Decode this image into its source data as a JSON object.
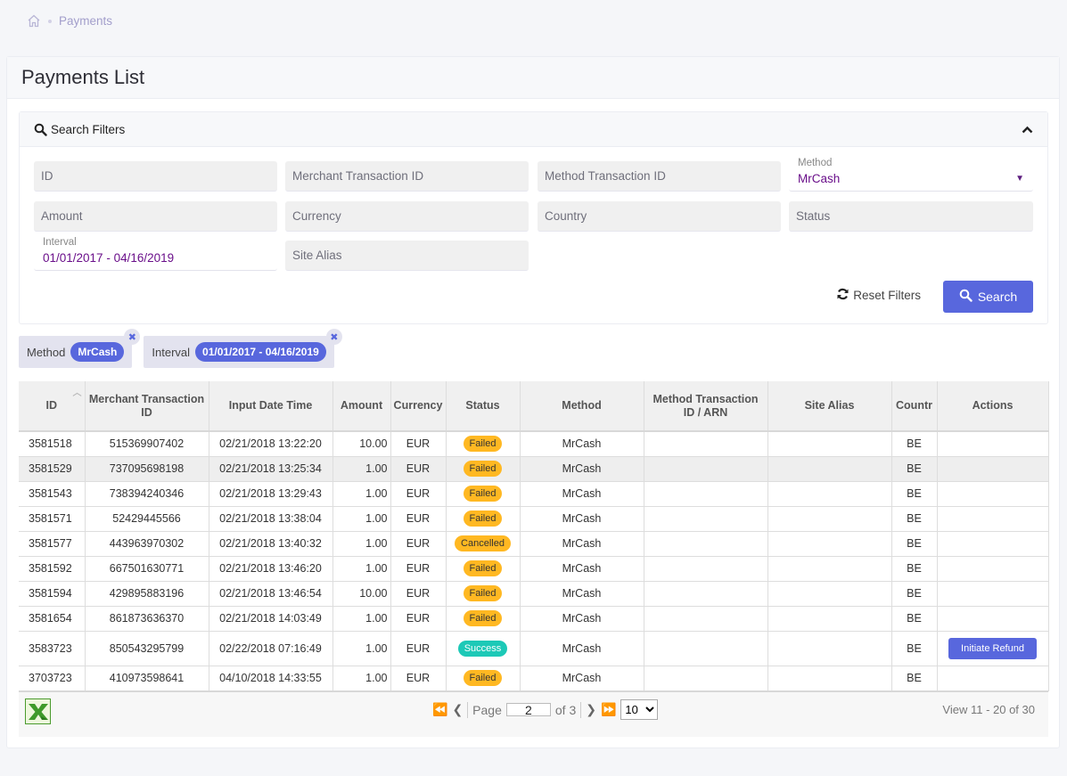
{
  "breadcrumb": {
    "home_icon": "home-icon",
    "current": "Payments"
  },
  "page": {
    "title": "Payments List"
  },
  "filters": {
    "title": "Search Filters",
    "fields": {
      "id": {
        "placeholder": "ID"
      },
      "merchant_tx_id": {
        "placeholder": "Merchant Transaction ID"
      },
      "method_tx_id": {
        "placeholder": "Method Transaction ID"
      },
      "method": {
        "label": "Method",
        "value": "MrCash"
      },
      "amount": {
        "placeholder": "Amount"
      },
      "currency": {
        "placeholder": "Currency"
      },
      "country": {
        "placeholder": "Country"
      },
      "status": {
        "placeholder": "Status"
      },
      "interval": {
        "label": "Interval",
        "value": "01/01/2017 - 04/16/2019"
      },
      "site_alias": {
        "placeholder": "Site Alias"
      }
    },
    "reset_label": "Reset Filters",
    "search_label": "Search"
  },
  "chips": [
    {
      "label": "Method",
      "value": "MrCash"
    },
    {
      "label": "Interval",
      "value": "01/01/2017 - 04/16/2019"
    }
  ],
  "table": {
    "columns": [
      "ID",
      "Merchant Transaction ID",
      "Input Date Time",
      "Amount",
      "Currency",
      "Status",
      "Method",
      "Method Transaction ID / ARN",
      "Site Alias",
      "Country",
      "Actions"
    ],
    "column_display": [
      "ID",
      "Merchant Transaction ID",
      "Input Date Time",
      "Amount",
      "Currency",
      "Status",
      "Method",
      "Method Transaction ID / ARN",
      "Site Alias",
      "Countr",
      "Actions"
    ],
    "rows": [
      {
        "id": "3581518",
        "merchant_tx": "515369907402",
        "datetime": "02/21/2018 13:22:20",
        "amount": "10.00",
        "currency": "EUR",
        "status": "Failed",
        "method": "MrCash",
        "method_tx": "",
        "site_alias": "",
        "country": "BE",
        "action": ""
      },
      {
        "id": "3581529",
        "merchant_tx": "737095698198",
        "datetime": "02/21/2018 13:25:34",
        "amount": "1.00",
        "currency": "EUR",
        "status": "Failed",
        "method": "MrCash",
        "method_tx": "",
        "site_alias": "",
        "country": "BE",
        "action": ""
      },
      {
        "id": "3581543",
        "merchant_tx": "738394240346",
        "datetime": "02/21/2018 13:29:43",
        "amount": "1.00",
        "currency": "EUR",
        "status": "Failed",
        "method": "MrCash",
        "method_tx": "",
        "site_alias": "",
        "country": "BE",
        "action": ""
      },
      {
        "id": "3581571",
        "merchant_tx": "52429445566",
        "datetime": "02/21/2018 13:38:04",
        "amount": "1.00",
        "currency": "EUR",
        "status": "Failed",
        "method": "MrCash",
        "method_tx": "",
        "site_alias": "",
        "country": "BE",
        "action": ""
      },
      {
        "id": "3581577",
        "merchant_tx": "443963970302",
        "datetime": "02/21/2018 13:40:32",
        "amount": "1.00",
        "currency": "EUR",
        "status": "Cancelled",
        "method": "MrCash",
        "method_tx": "",
        "site_alias": "",
        "country": "BE",
        "action": ""
      },
      {
        "id": "3581592",
        "merchant_tx": "667501630771",
        "datetime": "02/21/2018 13:46:20",
        "amount": "1.00",
        "currency": "EUR",
        "status": "Failed",
        "method": "MrCash",
        "method_tx": "",
        "site_alias": "",
        "country": "BE",
        "action": ""
      },
      {
        "id": "3581594",
        "merchant_tx": "429895883196",
        "datetime": "02/21/2018 13:46:54",
        "amount": "10.00",
        "currency": "EUR",
        "status": "Failed",
        "method": "MrCash",
        "method_tx": "",
        "site_alias": "",
        "country": "BE",
        "action": ""
      },
      {
        "id": "3581654",
        "merchant_tx": "861873636370",
        "datetime": "02/21/2018 14:03:49",
        "amount": "1.00",
        "currency": "EUR",
        "status": "Failed",
        "method": "MrCash",
        "method_tx": "",
        "site_alias": "",
        "country": "BE",
        "action": ""
      },
      {
        "id": "3583723",
        "merchant_tx": "850543295799",
        "datetime": "02/22/2018 07:16:49",
        "amount": "1.00",
        "currency": "EUR",
        "status": "Success",
        "method": "MrCash",
        "method_tx": "",
        "site_alias": "",
        "country": "BE",
        "action": "Initiate Refund"
      },
      {
        "id": "3703723",
        "merchant_tx": "410973598641",
        "datetime": "04/10/2018 14:33:55",
        "amount": "1.00",
        "currency": "EUR",
        "status": "Failed",
        "method": "MrCash",
        "method_tx": "",
        "site_alias": "",
        "country": "BE",
        "action": ""
      }
    ]
  },
  "status_colors": {
    "Failed": "#ffb822",
    "Cancelled": "#ffb822",
    "Success": "#1dc9b7"
  },
  "accent_color": "#5867dd",
  "pager": {
    "page_label": "Page",
    "current_page": "2",
    "of_label": "of 3",
    "page_size": "10",
    "view_info": "View 11 - 20 of 30",
    "export_icon": "excel-icon"
  }
}
